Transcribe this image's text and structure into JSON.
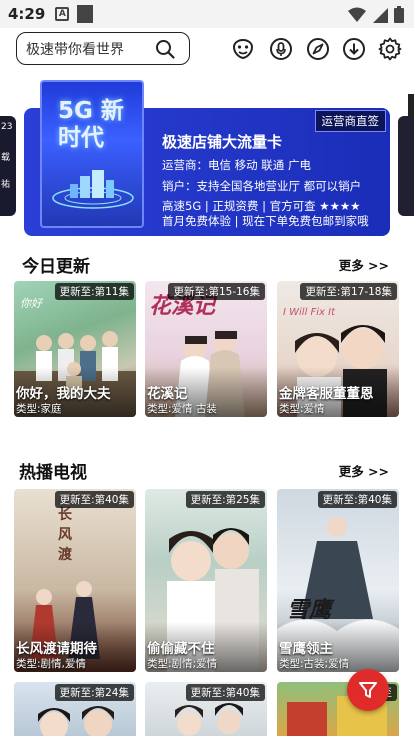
{
  "status": {
    "time": "4:29"
  },
  "search": {
    "placeholder": "极速带你看世界"
  },
  "icons": [
    "drama-mask-icon",
    "mic-icon",
    "compass-icon",
    "download-icon",
    "gear-icon"
  ],
  "banner": {
    "badge": "运营商直签",
    "title": "极速店铺大流量卡",
    "line1": "运营商：电信 移动 联通 广电",
    "line2": "销户：支持全国各地营业厅 都可以销户",
    "line3": "高速5G | 正规资费 | 官方可查 ★★★★",
    "line4": "首月免费体验 | 现在下单免费包邮到家哦",
    "poster_text": "5G 新时代"
  },
  "sections": [
    {
      "title": "今日更新",
      "more": "更多 >>",
      "items": [
        {
          "title": "你好，我的大夫",
          "type": "类型:家庭",
          "episode": "更新至:第11集"
        },
        {
          "title": "花溪记",
          "type": "类型:爱情 古装",
          "episode": "更新至:第15-16集"
        },
        {
          "title": "金牌客服董董恩",
          "type": "类型:爱情",
          "episode": "更新至:第17-18集"
        }
      ]
    },
    {
      "title": "热播电视",
      "more": "更多 >>",
      "items": [
        {
          "title": "长风渡请期待",
          "type": "类型:剧情,爱情",
          "episode": "更新至:第40集"
        },
        {
          "title": "偷偷藏不住",
          "type": "类型:剧情;爱情",
          "episode": "更新至:第25集"
        },
        {
          "title": "雪鹰领主",
          "type": "类型:古装;爱情",
          "episode": "更新至:第40集"
        }
      ]
    }
  ],
  "bottom_row": [
    {
      "episode": "更新至:第24集"
    },
    {
      "episode": "更新至:第40集"
    },
    {
      "episode": "更新至"
    }
  ],
  "colors": {
    "banner": "#2b3fd6",
    "fab": "#e02b2b"
  }
}
